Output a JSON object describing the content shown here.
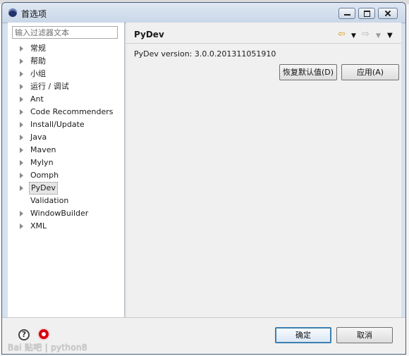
{
  "window": {
    "title": "首选项"
  },
  "filter": {
    "placeholder": "输入过滤器文本"
  },
  "tree": [
    {
      "label": "常规",
      "expandable": true
    },
    {
      "label": "帮助",
      "expandable": true
    },
    {
      "label": "小组",
      "expandable": true
    },
    {
      "label": "运行 / 调试",
      "expandable": true
    },
    {
      "label": "Ant",
      "expandable": true
    },
    {
      "label": "Code Recommenders",
      "expandable": true
    },
    {
      "label": "Install/Update",
      "expandable": true
    },
    {
      "label": "Java",
      "expandable": true
    },
    {
      "label": "Maven",
      "expandable": true
    },
    {
      "label": "Mylyn",
      "expandable": true
    },
    {
      "label": "Oomph",
      "expandable": true
    },
    {
      "label": "PyDev",
      "expandable": true,
      "selected": true
    },
    {
      "label": "Validation",
      "expandable": false
    },
    {
      "label": "WindowBuilder",
      "expandable": true
    },
    {
      "label": "XML",
      "expandable": true
    }
  ],
  "page": {
    "title": "PyDev",
    "version_text": "PyDev version: 3.0.0.201311051910",
    "restore_defaults_label": "恢复默认值(D)",
    "apply_label": "应用(A)"
  },
  "footer": {
    "ok_label": "确定",
    "cancel_label": "取消",
    "watermark": "Bai 贴吧 | python8"
  },
  "icons": {
    "back": "back-arrow-icon",
    "forward": "forward-arrow-icon",
    "help": "help-icon",
    "record": "record-icon"
  }
}
